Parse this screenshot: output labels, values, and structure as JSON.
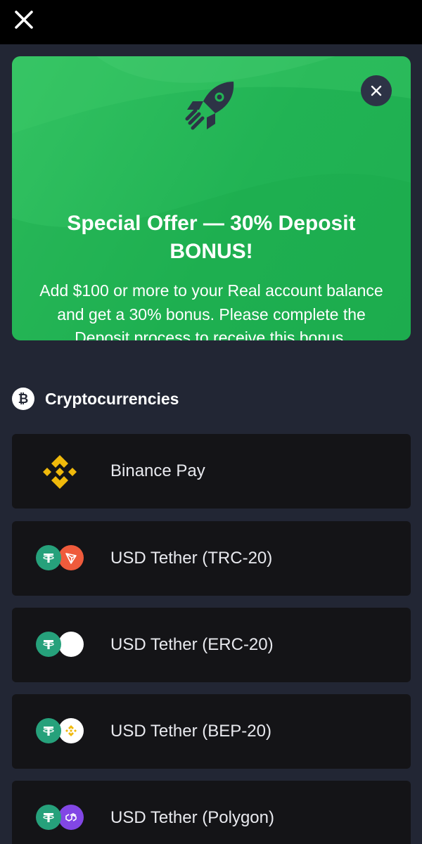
{
  "header": {
    "close_icon": "close-icon"
  },
  "promo": {
    "title": "Special Offer — 30% Deposit BONUS!",
    "body": "Add $100 or more to your Real account balance and get a 30% bonus. Please complete the Deposit process to receive this bonus.",
    "icon": "rocket-icon",
    "close_icon": "close-icon",
    "colors": {
      "background": "#22b455",
      "close_bg": "#2d3346",
      "rocket": "#2d3346"
    }
  },
  "section": {
    "icon": "bitcoin-icon",
    "icon_glyph": "₿",
    "title": "Cryptocurrencies"
  },
  "methods": [
    {
      "label": "Binance Pay",
      "icon": "binance-icon"
    },
    {
      "label": "USD Tether (TRC-20)",
      "icon": "tether-tron-icon"
    },
    {
      "label": "USD Tether (ERC-20)",
      "icon": "tether-ethereum-icon"
    },
    {
      "label": "USD Tether (BEP-20)",
      "icon": "tether-bnb-icon"
    },
    {
      "label": "USD Tether (Polygon)",
      "icon": "tether-polygon-icon"
    }
  ],
  "colors": {
    "page_bg": "#222634",
    "card_bg": "#141417",
    "tether": "#26a17b",
    "tron": "#ef5b3c",
    "binance": "#f0b90b",
    "polygon": "#8247e5"
  }
}
